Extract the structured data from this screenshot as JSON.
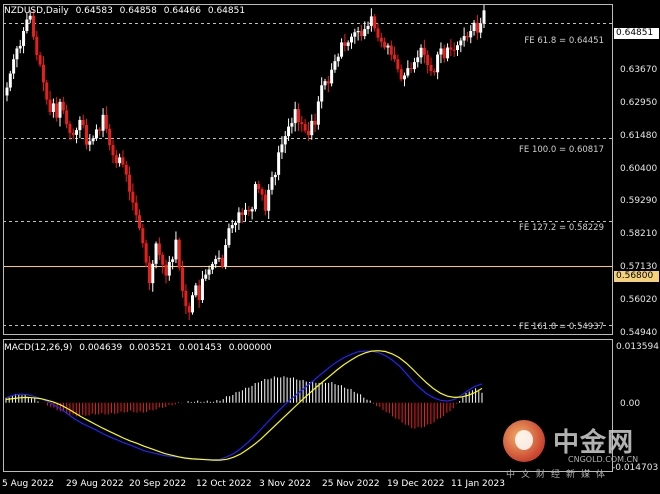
{
  "symbol": {
    "name": "NZDUSD,Daily",
    "open": "0.64583",
    "high": "0.64858",
    "low": "0.64466",
    "close": "0.64851"
  },
  "price_axis": {
    "ticks": [
      "0.64851",
      "0.63670",
      "0.62950",
      "0.61480",
      "0.60400",
      "0.59290",
      "0.58210",
      "0.57130",
      "0.56800",
      "0.56020",
      "0.54940"
    ],
    "current_price": "0.64851",
    "marked_level": "0.56800"
  },
  "fib_levels": [
    {
      "label": "FE 61.8 = 0.64451",
      "value": 0.64451
    },
    {
      "label": "FE 100.0 = 0.60817",
      "value": 0.60817
    },
    {
      "label": "FE 127.2 = 0.58229",
      "value": 0.58229
    },
    {
      "label": "FE 161.8 = 0.54937",
      "value": 0.54937
    }
  ],
  "horizontal_level": {
    "value": 0.568
  },
  "macd": {
    "name": "MACD(12,26,9)",
    "v1": "0.004639",
    "v2": "0.003521",
    "v3": "0.001453",
    "v4": "0.000000",
    "axis_ticks": [
      "0.013594",
      "0.00",
      "-0.014703"
    ]
  },
  "x_axis": [
    "5 Aug 2022",
    "29 Aug 2022",
    "20 Sep 2022",
    "12 Oct 2022",
    "3 Nov 2022",
    "25 Nov 2022",
    "19 Dec 2022",
    "11 Jan 2023"
  ],
  "watermark": {
    "cn": "中金网",
    "url": "CNGOLD.COM.CN",
    "sub": "中文财经新媒体"
  },
  "colors": {
    "bull": "#ffffff",
    "bear": "#e8201c",
    "macd_line": "#2222ff",
    "signal_line": "#ffff00",
    "hist_pos": "#ffffff",
    "hist_neg": "#e8201c",
    "level": "#ffcc33",
    "grid": "#c0c0c0"
  },
  "chart_data": {
    "type": "candlestick",
    "price_ylim": [
      0.5466,
      0.6505
    ],
    "closes": [
      0.6242,
      0.6286,
      0.6331,
      0.6365,
      0.6373,
      0.642,
      0.6456,
      0.6468,
      0.6402,
      0.6344,
      0.6314,
      0.6258,
      0.6204,
      0.6165,
      0.6192,
      0.6147,
      0.6197,
      0.617,
      0.6127,
      0.6099,
      0.6093,
      0.6108,
      0.614,
      0.6124,
      0.6062,
      0.6073,
      0.6082,
      0.611,
      0.6106,
      0.6156,
      0.6112,
      0.6061,
      0.6029,
      0.6004,
      0.6022,
      0.5999,
      0.5968,
      0.5914,
      0.588,
      0.584,
      0.5799,
      0.5752,
      0.5691,
      0.5626,
      0.5687,
      0.5751,
      0.5715,
      0.5684,
      0.565,
      0.5693,
      0.5701,
      0.5763,
      0.5675,
      0.5602,
      0.5554,
      0.5534,
      0.5588,
      0.5619,
      0.5573,
      0.564,
      0.5653,
      0.5669,
      0.5686,
      0.5702,
      0.5706,
      0.5678,
      0.5746,
      0.5799,
      0.5809,
      0.5816,
      0.5849,
      0.5841,
      0.5857,
      0.5852,
      0.5859,
      0.5938,
      0.5922,
      0.5905,
      0.5854,
      0.592,
      0.596,
      0.5967,
      0.6038,
      0.6063,
      0.6089,
      0.6119,
      0.613,
      0.6174,
      0.6133,
      0.6127,
      0.6106,
      0.6092,
      0.6137,
      0.6125,
      0.6198,
      0.6249,
      0.6262,
      0.6255,
      0.6298,
      0.6325,
      0.6339,
      0.6384,
      0.6373,
      0.6384,
      0.6402,
      0.6416,
      0.642,
      0.6404,
      0.6426,
      0.6436,
      0.6466,
      0.6428,
      0.6399,
      0.6386,
      0.6368,
      0.6374,
      0.6345,
      0.6331,
      0.63,
      0.6268,
      0.628,
      0.6303,
      0.63,
      0.6322,
      0.6337,
      0.6367,
      0.6345,
      0.6313,
      0.6294,
      0.629,
      0.6346,
      0.6365,
      0.6334,
      0.6368,
      0.6361,
      0.636,
      0.6375,
      0.639,
      0.6404,
      0.64,
      0.642,
      0.6446,
      0.6415,
      0.6444,
      0.6485
    ],
    "macd_ylim": [
      -0.014703,
      0.013594
    ],
    "macd": [
      0.0012,
      0.0018,
      0.0021,
      0.002,
      0.0016,
      0.001,
      0.0003,
      -0.0006,
      -0.0016,
      -0.0028,
      -0.004,
      -0.005,
      -0.0058,
      -0.0066,
      -0.0075,
      -0.0083,
      -0.009,
      -0.0097,
      -0.0103,
      -0.011,
      -0.0117,
      -0.0121,
      -0.0125,
      -0.0129,
      -0.0131,
      -0.0133,
      -0.0135,
      -0.0136,
      -0.0137,
      -0.0138,
      -0.0139,
      -0.0138,
      -0.0132,
      -0.0124,
      -0.0112,
      -0.0098,
      -0.0082,
      -0.0064,
      -0.0046,
      -0.0028,
      -0.0012,
      0.0004,
      0.0018,
      0.0032,
      0.0046,
      0.006,
      0.0074,
      0.0088,
      0.01,
      0.011,
      0.0118,
      0.0124,
      0.0126,
      0.0126,
      0.0122,
      0.0115,
      0.0104,
      0.009,
      0.0072,
      0.0052,
      0.0036,
      0.0022,
      0.0012,
      0.0006,
      0.0004,
      0.0008,
      0.0018,
      0.003,
      0.004,
      0.0046
    ],
    "signal": [
      0.0008,
      0.001,
      0.0012,
      0.0013,
      0.0012,
      0.001,
      0.0006,
      0.0001,
      -0.0006,
      -0.0015,
      -0.0025,
      -0.0035,
      -0.0044,
      -0.0053,
      -0.0062,
      -0.007,
      -0.0078,
      -0.0086,
      -0.0093,
      -0.0099,
      -0.0106,
      -0.0112,
      -0.0118,
      -0.0124,
      -0.0128,
      -0.0132,
      -0.0135,
      -0.0137,
      -0.0138,
      -0.0139,
      -0.014,
      -0.014,
      -0.0138,
      -0.0133,
      -0.0125,
      -0.0114,
      -0.0102,
      -0.0088,
      -0.0072,
      -0.0056,
      -0.004,
      -0.0024,
      -0.0008,
      0.0008,
      0.0023,
      0.0038,
      0.0052,
      0.0066,
      0.008,
      0.0093,
      0.0104,
      0.0114,
      0.0121,
      0.0126,
      0.0127,
      0.0125,
      0.0119,
      0.011,
      0.0097,
      0.0081,
      0.0064,
      0.0048,
      0.0034,
      0.0023,
      0.0016,
      0.0013,
      0.0014,
      0.0018,
      0.0025,
      0.0035
    ]
  }
}
